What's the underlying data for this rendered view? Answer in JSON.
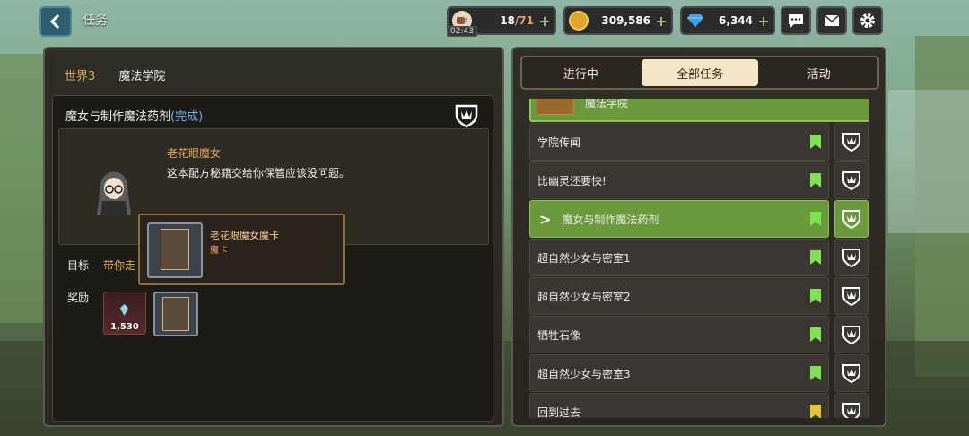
{
  "header": {
    "title": "任务",
    "stamina": {
      "current": "18",
      "total": "/71",
      "timer": "02:43"
    },
    "gold": "309,586",
    "gems": "6,344"
  },
  "colors": {
    "green_bookmark": "#7fe34f",
    "yellow_bookmark": "#e6c23b",
    "accent_orange": "#e2a95c"
  },
  "left": {
    "world": "世界3",
    "area": "魔法学院",
    "quest_title": "魔女与制作魔法药剂",
    "quest_status": "(完成)",
    "npc_name": "老花眼魔女",
    "npc_line": "这本配方秘籍交给你保管应该没问题。",
    "goal_label": "目标",
    "goal_text": "带你走",
    "reward_label": "奖励",
    "reward_gem_qty": "1,530",
    "tooltip_name": "老花眼魔女魔卡",
    "tooltip_type": "魔卡"
  },
  "right": {
    "tabs": [
      {
        "label": "进行中"
      },
      {
        "label": "全部任务"
      },
      {
        "label": "活动"
      }
    ],
    "group_header": "魔法学院",
    "quests": [
      {
        "title": "学院传闻",
        "bookmark": "green"
      },
      {
        "title": "比幽灵还要快!",
        "bookmark": "green"
      },
      {
        "title": "魔女与制作魔法药剂",
        "bookmark": "green"
      },
      {
        "title": "超自然少女与密室1",
        "bookmark": "green"
      },
      {
        "title": "超自然少女与密室2",
        "bookmark": "green"
      },
      {
        "title": "牺牲石像",
        "bookmark": "green"
      },
      {
        "title": "超自然少女与密室3",
        "bookmark": "green"
      },
      {
        "title": "回到过去",
        "bookmark": "yellow"
      }
    ]
  }
}
